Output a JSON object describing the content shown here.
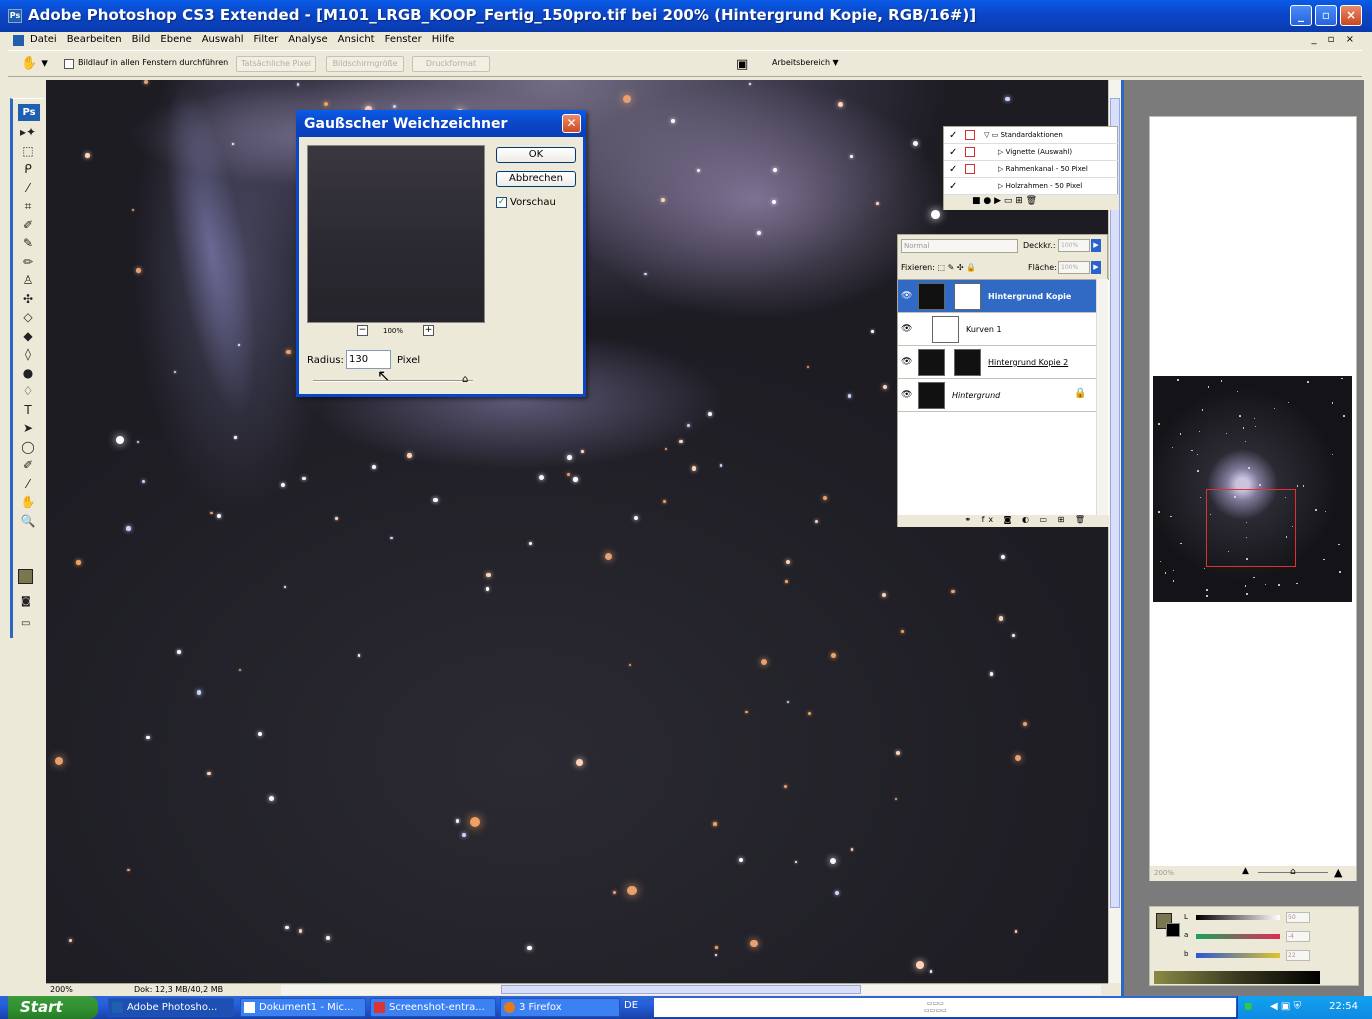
{
  "window": {
    "title": "Adobe Photoshop CS3 Extended - [M101_LRGB_KOOP_Fertig_150pro.tif bei 200% (Hintergrund Kopie, RGB/16#)]",
    "controls": [
      "_",
      "▫",
      "×"
    ]
  },
  "menu": {
    "items": [
      "Datei",
      "Bearbeiten",
      "Bild",
      "Ebene",
      "Auswahl",
      "Filter",
      "Analyse",
      "Ansicht",
      "Fenster",
      "Hilfe"
    ],
    "doc_controls": "_ ▫ ×"
  },
  "options_bar": {
    "checkbox_label": "Bildlauf in allen Fenstern durchführen",
    "buttons": [
      "Tatsächliche Pixel",
      "Bildschirmgröße",
      "Druckformat"
    ],
    "workspace_label": "Arbeitsbereich ▼"
  },
  "toolbox": {
    "logo": "Ps",
    "tools": [
      "▸✦",
      "⬚",
      "ᑭ",
      "⁄",
      "⌗",
      "✐",
      "✎",
      "✏",
      "♙",
      "✣",
      "◇",
      "◆",
      "◊",
      "●",
      "♢",
      "T",
      "➤",
      "◯",
      "✐",
      "⁄",
      "✋",
      "🔍"
    ]
  },
  "dialog": {
    "title": "Gaußscher Weichzeichner",
    "ok_label": "OK",
    "cancel_label": "Abbrechen",
    "preview_checked": "✓",
    "preview_label": "Vorschau",
    "zoom_minus": "−",
    "zoom_value": "100%",
    "zoom_plus": "+",
    "radius_label": "Radius:",
    "radius_value": "130",
    "radius_unit": "Pixel"
  },
  "actions_panel": {
    "rows": [
      {
        "label": "▽ ▭ Standardaktionen",
        "check": "✓"
      },
      {
        "label": "▷ Vignette (Auswahl)",
        "check": "✓"
      },
      {
        "label": "▷ Rahmenkanal - 50 Pixel",
        "check": "✓"
      },
      {
        "label": "▷ Holzrahmen - 50 Pixel",
        "check": "✓"
      }
    ],
    "footer_icons": "■  ●  ▶  ▭  ⊞  🗑"
  },
  "layers_panel": {
    "blend_mode": "Normal",
    "opacity_label": "Deckkr.:",
    "opacity_value": "100%",
    "lock_label": "Fixieren: ⬚ ✎ ✣ 🔒",
    "fill_label": "Fläche:",
    "fill_value": "100%",
    "layers": [
      {
        "name": "Hintergrund Kopie",
        "active": true
      },
      {
        "name": "Kurven 1",
        "active": false
      },
      {
        "name": "Hintergrund Kopie 2",
        "active": false
      },
      {
        "name": "Hintergrund",
        "active": false,
        "locked": true
      }
    ],
    "footer_icons": "⚭ fx ◙ ◐ ▭ ⊞ 🗑"
  },
  "status": {
    "zoom": "200%",
    "doc_size": "Dok: 12,3 MB/40,2 MB"
  },
  "navigator": {
    "zoom": "200%"
  },
  "color_panel": {
    "labels": [
      "L",
      "a",
      "b"
    ],
    "values": [
      "50",
      "-4",
      "22"
    ]
  },
  "taskbar": {
    "start_label": "Start",
    "items": [
      "Adobe Photosho...",
      "Dokument1 - Mic...",
      "Screenshot-entra...",
      "3 Firefox"
    ],
    "language": "DE",
    "clock": "22:54"
  },
  "colors": {
    "xp_blue": "#0a46c8",
    "selection_blue": "#316ac5",
    "canvas_dark": "#1d1c23",
    "navigator_rect": "#e03030"
  }
}
